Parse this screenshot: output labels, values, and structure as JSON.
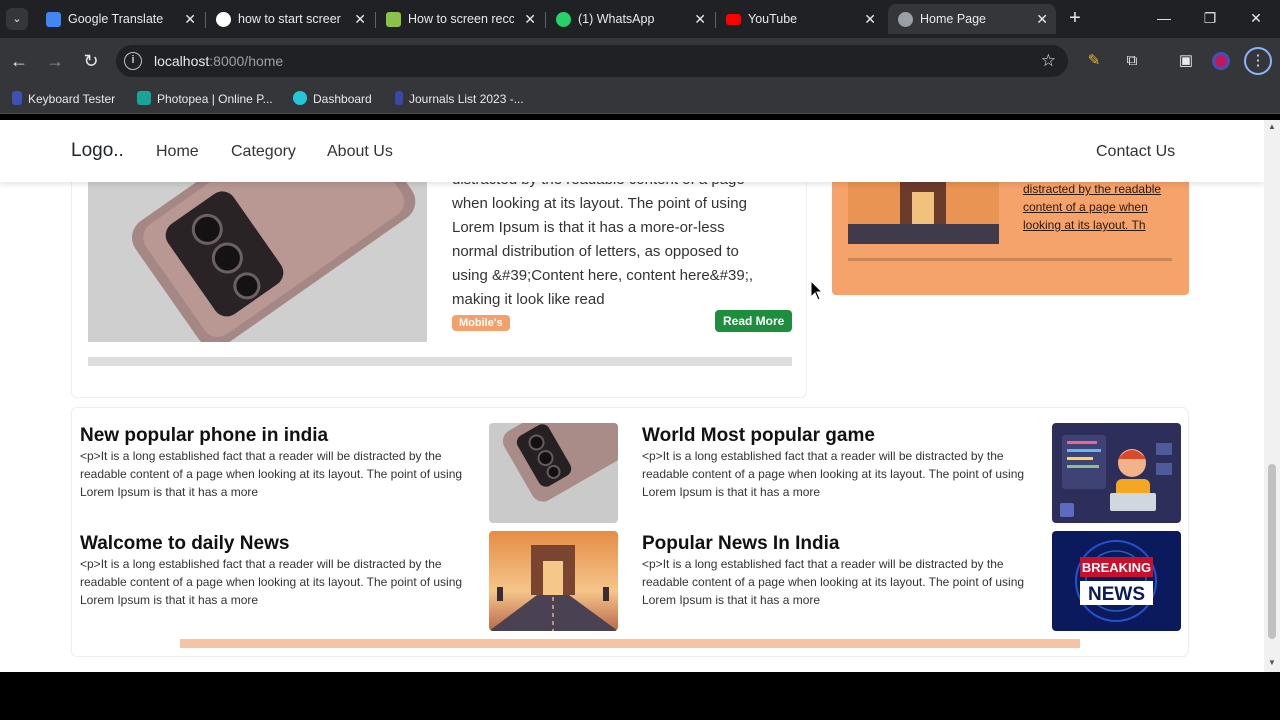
{
  "browser": {
    "tabs": [
      {
        "title": "Google Translate",
        "color": "#4285f4"
      },
      {
        "title": "how to start screer",
        "color": "#ffffff"
      },
      {
        "title": "How to screen recc",
        "color": "#8bc34a"
      },
      {
        "title": "(1) WhatsApp",
        "color": "#25d366"
      },
      {
        "title": "YouTube",
        "color": "#ff0000"
      },
      {
        "title": "Home Page",
        "color": "#9aa0a6"
      }
    ],
    "url_host": "localhost",
    "url_path": ":8000/home",
    "bookmarks": [
      {
        "label": "Keyboard Tester",
        "color": "#3f51b5"
      },
      {
        "label": "Photopea | Online P...",
        "color": "#18a497"
      },
      {
        "label": "Dashboard",
        "color": "#26c6da"
      },
      {
        "label": "Journals List 2023 -...",
        "color": "#3949ab"
      }
    ]
  },
  "site": {
    "logo": "Logo..",
    "nav": [
      "Home",
      "Category",
      "About Us"
    ],
    "contact": "Contact Us"
  },
  "featured": {
    "text_lines": [
      "distracted by the readable content of a page",
      "when looking at its layout. The point of using",
      "Lorem Ipsum is that it has a more-or-less",
      "normal distribution of letters, as opposed to",
      "using &#39;Content here, content here&#39;,",
      "making it look like read"
    ],
    "tag": "Mobile's",
    "read_more": "Read More"
  },
  "side": {
    "link_lines": [
      "distracted by the readable",
      "content of a page when",
      "looking at its layout. Th"
    ],
    "accent": "#f6a36b"
  },
  "news": [
    {
      "title": "New popular phone in india",
      "line1": "<p>It is a long established fact that a reader will be distracted by the",
      "line2": "readable content of a page when looking at its layout. The point of using",
      "line3": "Lorem Ipsum is that it has a more",
      "image": "phone"
    },
    {
      "title": "World Most popular game",
      "line1": "<p>It is a long established fact that a reader will be distracted by the",
      "line2": "readable content of a page when looking at its layout. The point of using",
      "line3": "Lorem Ipsum is that it has a more",
      "image": "developer"
    },
    {
      "title": "Walcome to daily News",
      "line1": "<p>It is a long established fact that a reader will be distracted by the",
      "line2": "readable content of a page when looking at its layout. The point of using",
      "line3": "Lorem Ipsum is that it has a more",
      "image": "india-gate"
    },
    {
      "title": "Popular News In India",
      "line1": "<p>It is a long established fact that a reader will be distracted by the",
      "line2": "readable content of a page when looking at its layout. The point of using",
      "line3": "Lorem Ipsum is that it has a more",
      "image": "breaking-news"
    }
  ],
  "breaking": {
    "top": "BREAKING",
    "bottom": "NEWS"
  }
}
